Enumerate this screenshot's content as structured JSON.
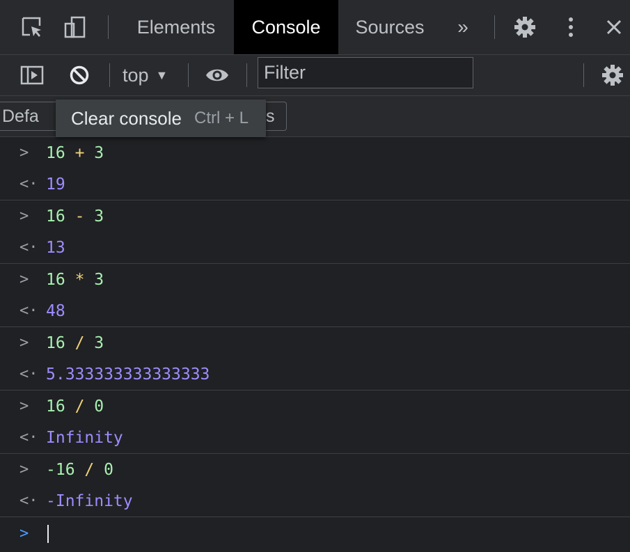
{
  "tabbar": {
    "tabs": [
      {
        "label": "Elements",
        "active": false
      },
      {
        "label": "Console",
        "active": true
      },
      {
        "label": "Sources",
        "active": false
      }
    ],
    "more_tabs_label": "»",
    "icons": [
      "inspect-element-icon",
      "device-toolbar-icon",
      "gear-icon",
      "kebab-menu-icon",
      "close-icon"
    ]
  },
  "toolbar": {
    "context_label": "top",
    "context_caret": "▼",
    "filter_placeholder": "Filter",
    "icons": [
      "sidebar-toggle-icon",
      "clear-console-icon",
      "eye-icon",
      "gear-icon"
    ]
  },
  "levels": {
    "label_visible_start": "Defa",
    "label_visible_end": "s"
  },
  "tooltip": {
    "label": "Clear console",
    "shortcut": "Ctrl + L"
  },
  "console": {
    "entries": [
      {
        "left": "16",
        "op": "+",
        "right": "3",
        "result": "19"
      },
      {
        "left": "16",
        "op": "-",
        "right": "3",
        "result": "13"
      },
      {
        "left": "16",
        "op": "*",
        "right": "3",
        "result": "48"
      },
      {
        "left": "16",
        "op": "/",
        "right": "3",
        "result": "5.333333333333333"
      },
      {
        "left": "16",
        "op": "/",
        "right": "0",
        "result": "Infinity"
      },
      {
        "left": "-16",
        "op": "/",
        "right": "0",
        "result": "-Infinity"
      }
    ],
    "input_prompt": ">",
    "output_prompt": "<·",
    "input_value": ""
  },
  "colors": {
    "background": "#202124",
    "toolbar": "#292a2d",
    "active_tab": "#000000",
    "number": "#9bf5a8",
    "operator": "#f0d27a",
    "result": "#9e8cff",
    "prompt_active": "#4d9cff"
  }
}
